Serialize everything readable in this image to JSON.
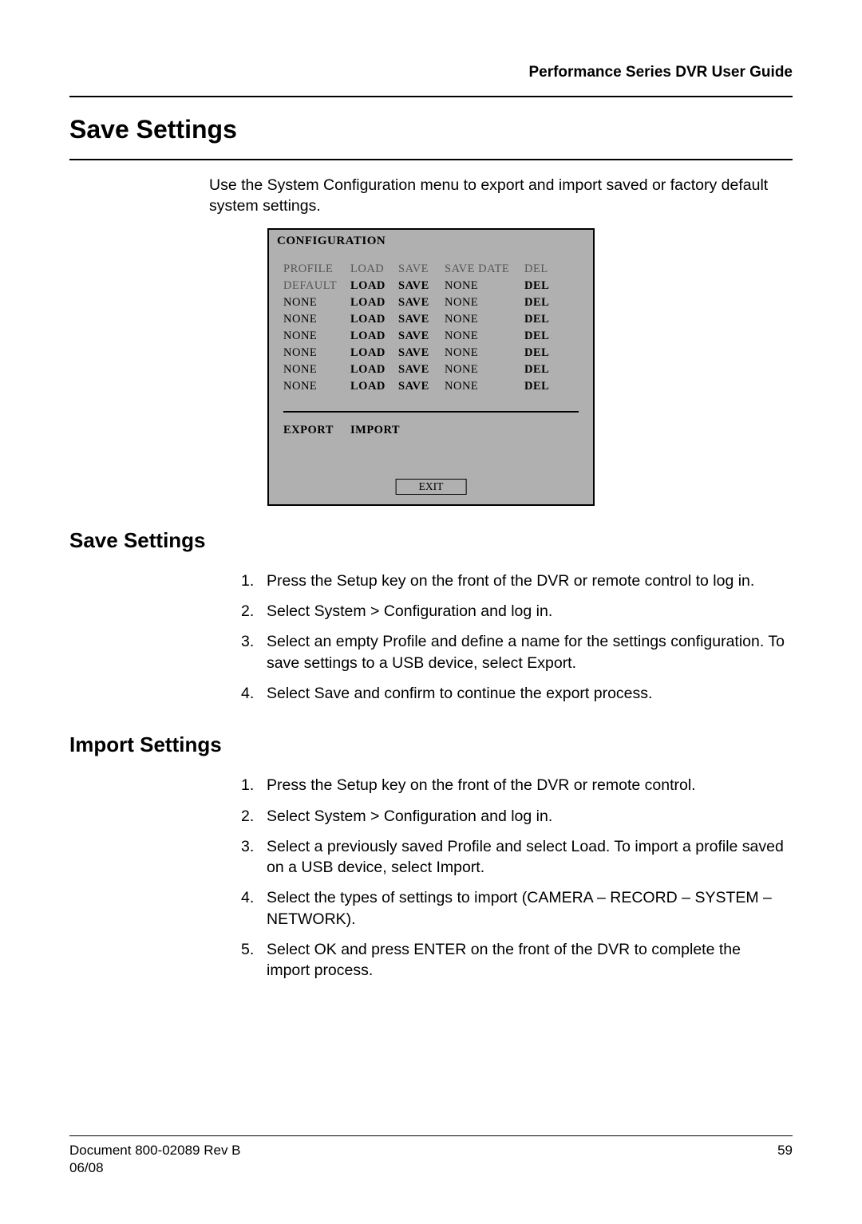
{
  "header": {
    "guide_title": "Performance Series DVR User Guide"
  },
  "title_main": "Save Settings",
  "intro": "Use the System Configuration menu to export and import saved or factory default system settings.",
  "config": {
    "title": "CONFIGURATION",
    "header_row": {
      "c1": "PROFILE",
      "c2": "LOAD",
      "c3": "SAVE",
      "c4": "SAVE DATE",
      "c5": "DEL"
    },
    "rows": [
      {
        "c1": "DEFAULT",
        "c2": "LOAD",
        "c3": "SAVE",
        "c4": "NONE",
        "c5": "DEL"
      },
      {
        "c1": "NONE",
        "c2": "LOAD",
        "c3": "SAVE",
        "c4": "NONE",
        "c5": "DEL"
      },
      {
        "c1": "NONE",
        "c2": "LOAD",
        "c3": "SAVE",
        "c4": "NONE",
        "c5": "DEL"
      },
      {
        "c1": "NONE",
        "c2": "LOAD",
        "c3": "SAVE",
        "c4": "NONE",
        "c5": "DEL"
      },
      {
        "c1": "NONE",
        "c2": "LOAD",
        "c3": "SAVE",
        "c4": "NONE",
        "c5": "DEL"
      },
      {
        "c1": "NONE",
        "c2": "LOAD",
        "c3": "SAVE",
        "c4": "NONE",
        "c5": "DEL"
      },
      {
        "c1": "NONE",
        "c2": "LOAD",
        "c3": "SAVE",
        "c4": "NONE",
        "c5": "DEL"
      }
    ],
    "export_label": "EXPORT",
    "import_label": "IMPORT",
    "exit_label": "EXIT"
  },
  "section_save": {
    "heading": "Save Settings",
    "steps": [
      "Press the Setup key on the front of the DVR or remote control to log in.",
      "Select System > Configuration and log in.",
      "Select an empty Profile and define a name for the settings configuration. To save settings to a USB device, select Export.",
      "Select Save and confirm to continue the export process."
    ]
  },
  "section_import": {
    "heading": "Import Settings",
    "steps": [
      "Press the Setup key on the front of the DVR or remote control.",
      "Select System > Configuration and log in.",
      "Select a previously saved Profile and select Load. To import a profile saved on a USB device, select Import.",
      "Select the types of settings to import (CAMERA – RECORD – SYSTEM – NETWORK).",
      "Select OK and press ENTER on the front of the DVR to complete the import process."
    ]
  },
  "footer": {
    "doc": "Document 800-02089  Rev B",
    "page": "59",
    "date": "06/08"
  }
}
